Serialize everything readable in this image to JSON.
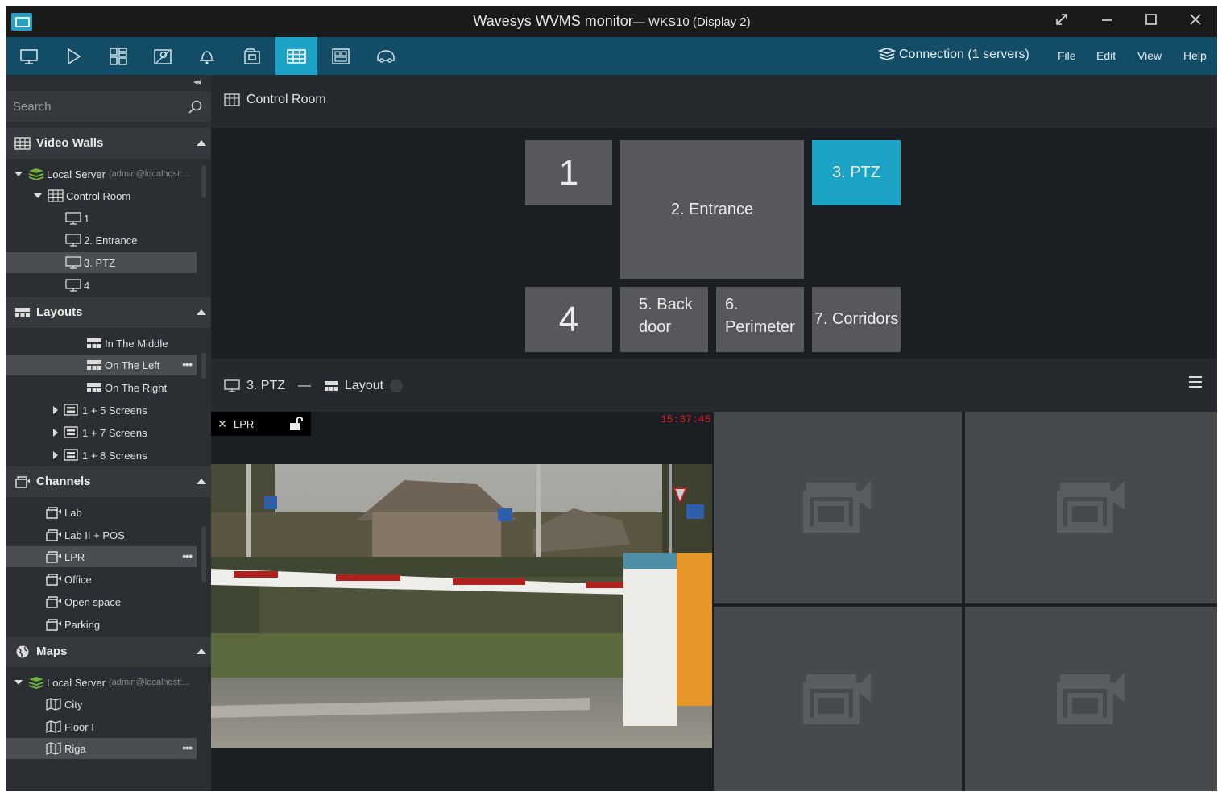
{
  "window": {
    "title": "Wavesys WVMS monitor",
    "subtitle": "— WKS10 (Display 2)"
  },
  "toolbar": {
    "buttons": [
      "monitor-icon",
      "play-icon",
      "layout-grid-icon",
      "map-icon",
      "bell-icon",
      "archive-icon",
      "video-wall-icon",
      "layout-editor-icon",
      "car-icon"
    ],
    "active_index": 6,
    "connection": "Connection (1 servers)",
    "menu": [
      "File",
      "Edit",
      "View",
      "Help"
    ],
    "accent_color": "#1ba3c6"
  },
  "sidebar": {
    "collapse_glyph": "◂◂",
    "search_placeholder": "Search",
    "video_walls": {
      "header": "Video Walls",
      "server_label": "Local Server",
      "server_sub": "(admin@localhost:...",
      "wall_label": "Control Room",
      "screens": [
        "1",
        "2. Entrance",
        "3. PTZ",
        "4"
      ],
      "selected": "3. PTZ"
    },
    "layouts": {
      "header": "Layouts",
      "items": [
        "In The Middle",
        "On The Left",
        "On The Right"
      ],
      "groups": [
        "1 +  5 Screens",
        "1 +  7 Screens",
        "1 +  8 Screens"
      ],
      "selected": "On The Left"
    },
    "channels": {
      "header": "Channels",
      "items": [
        "Lab",
        "Lab II + POS",
        "LPR",
        "Office",
        "Open space",
        "Parking"
      ],
      "selected": "LPR"
    },
    "maps": {
      "header": "Maps",
      "server_label": "Local Server",
      "server_sub": "(admin@localhost:...",
      "items": [
        "City",
        "Floor I",
        "Riga"
      ],
      "selected": "Riga"
    },
    "more_glyph": "•••"
  },
  "main": {
    "wall_title": "Control Room",
    "screens": {
      "s1": "1",
      "s2": "2. Entrance",
      "s3": "3. PTZ",
      "s4": "4",
      "s5a": "5. Back",
      "s5b": "door",
      "s6a": "6.",
      "s6b": "Perimeter",
      "s7": "7. Corridors"
    },
    "layout_bar": {
      "screen": "3. PTZ",
      "separator": "—",
      "layout": "Layout"
    },
    "player": {
      "close": "✕",
      "channel": "LPR",
      "timestamp": "15:37:45"
    }
  }
}
